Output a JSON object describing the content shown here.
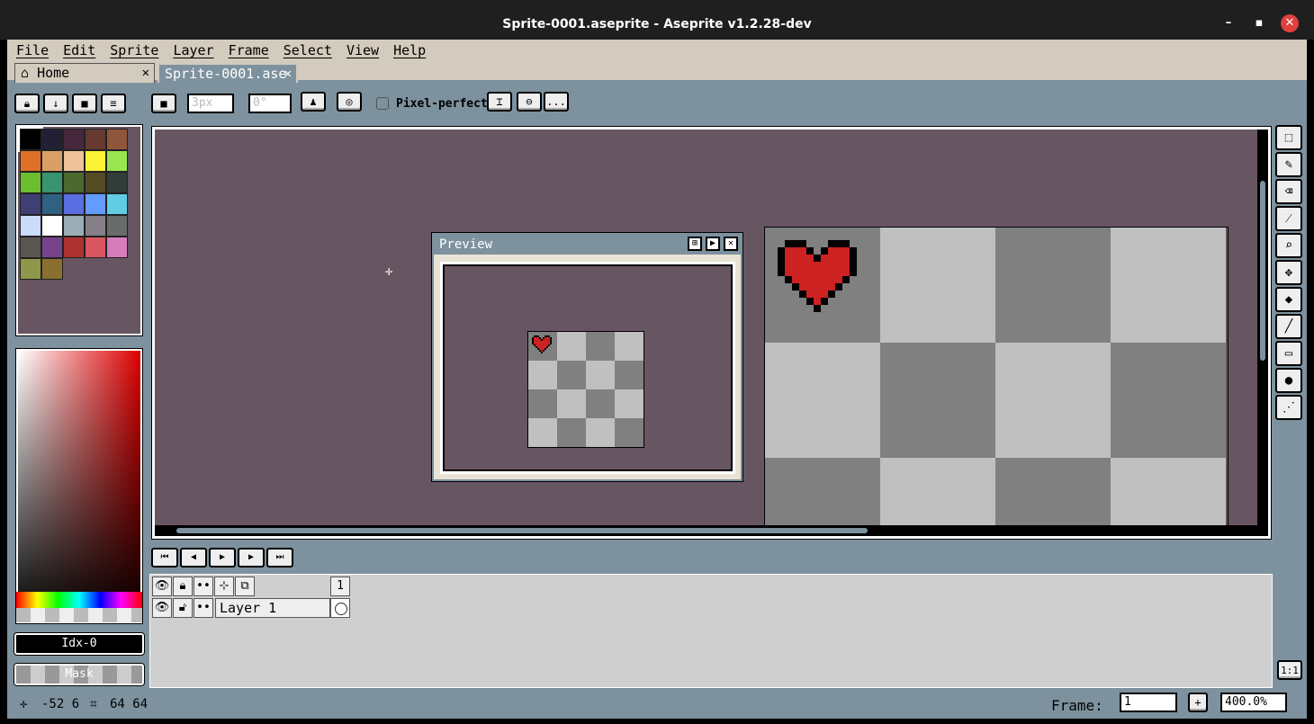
{
  "window": {
    "title": "Sprite-0001.aseprite - Aseprite v1.2.28-dev",
    "minimize": "–",
    "maximize": "▪",
    "close": "✕"
  },
  "menubar": {
    "items": [
      "File",
      "Edit",
      "Sprite",
      "Layer",
      "Frame",
      "Select",
      "View",
      "Help"
    ]
  },
  "tabs": [
    {
      "label": "Home",
      "close": "✕"
    },
    {
      "label": "Sprite-0001.ase",
      "close": "✕"
    }
  ],
  "toolbar": {
    "brush_size": "3px",
    "brush_angle": "0°",
    "pixel_perfect_label": "Pixel-perfect",
    "more": "..."
  },
  "palette": {
    "colors": [
      "#000000",
      "#222034",
      "#45283c",
      "#663931",
      "#8f563b",
      "#df7126",
      "#d9a066",
      "#eec39a",
      "#fbf236",
      "#99e550",
      "#6abe30",
      "#37946e",
      "#4b692f",
      "#524b24",
      "#323c39",
      "#3f3f74",
      "#306082",
      "#5b6ee1",
      "#639bff",
      "#5fcde4",
      "#cbdbfc",
      "#ffffff",
      "#9badb7",
      "#847e87",
      "#696a6a",
      "#595652",
      "#76428a",
      "#ac3232",
      "#d95763",
      "#d77bba",
      "#8f974a",
      "#8a6f30"
    ]
  },
  "color_bar": {
    "index_label": "Idx-0",
    "mask_label": "Mask"
  },
  "preview": {
    "title": "Preview"
  },
  "timeline": {
    "layer_name": "Layer 1",
    "frame_number": "1"
  },
  "status": {
    "cursor_coords": "-52 6",
    "sprite_size": "64 64",
    "frame_label": "Frame:",
    "frame_value": "1",
    "zoom": "400.0%",
    "add_frame": "+"
  },
  "colors": {
    "canvas_bg": "#685562",
    "panel": "#7d929e",
    "menu_bg": "#d3cbbe",
    "heart": "#cc2222"
  }
}
